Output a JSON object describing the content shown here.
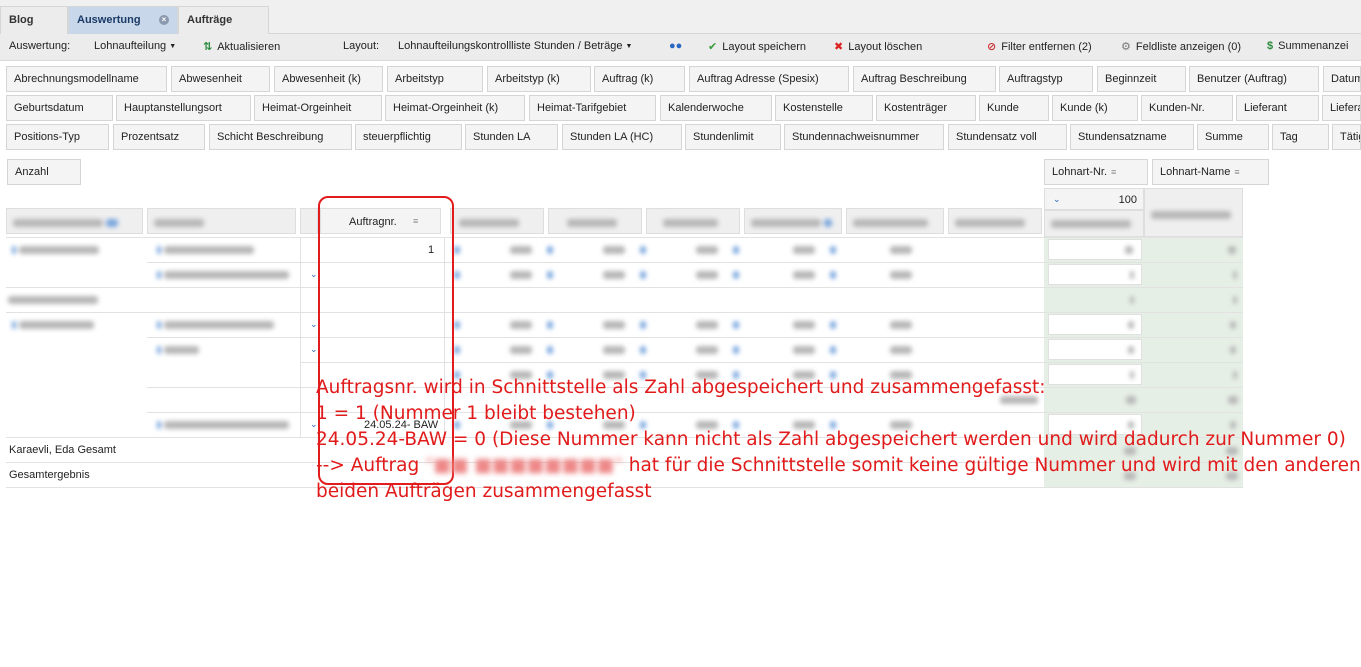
{
  "tabs": [
    {
      "label": "Blog"
    },
    {
      "label": "Auswertung",
      "active": true
    },
    {
      "label": "Aufträge"
    }
  ],
  "toolbar": {
    "auswertung_label": "Auswertung:",
    "auswertung_value": "Lohnaufteilung",
    "aktualisieren": "Aktualisieren",
    "layout_label": "Layout:",
    "layout_value": "Lohnaufteilungskontrollliste Stunden / Beträge",
    "layout_speichern": "Layout speichern",
    "layout_loeschen": "Layout löschen",
    "filter_entfernen": "Filter entfernen (2)",
    "feldliste": "Feldliste anzeigen (0)",
    "summen": "Summenanzei"
  },
  "fields": {
    "row1": [
      "Abrechnungsmodellname",
      "Abwesenheit",
      "Abwesenheit (k)",
      "Arbeitstyp",
      "Arbeitstyp (k)",
      "Auftrag (k)",
      "Auftrag Adresse (Spesix)",
      "Auftrag Beschreibung",
      "Auftragstyp",
      "Beginnzeit",
      "Benutzer (Auftrag)",
      "Datum"
    ],
    "row2": [
      "Geburtsdatum",
      "Hauptanstellungsort",
      "Heimat-Orgeinheit",
      "Heimat-Orgeinheit (k)",
      "Heimat-Tarifgebiet",
      "Kalenderwoche",
      "Kostenstelle",
      "Kostenträger",
      "Kunde",
      "Kunde (k)",
      "Kunden-Nr.",
      "Lieferant",
      "Liefera"
    ],
    "row3": [
      "Positions-Typ",
      "Prozentsatz",
      "Schicht Beschreibung",
      "steuerpflichtig",
      "Stunden LA",
      "Stunden LA (HC)",
      "Stundenlimit",
      "Stundennachweisnummer",
      "Stundensatz voll",
      "Stundensatzname",
      "Summe",
      "Tag",
      "Tätig"
    ]
  },
  "grid": {
    "data_area_button": "Anzahl",
    "column_buttons": [
      "Lohnart-Nr.",
      "Lohnart-Name"
    ],
    "column_value": "100",
    "auftragnr_header": "Auftragnr.",
    "auftragnr_values": [
      "1",
      "24.05.24- BAW"
    ],
    "group_total": "Karaevli, Eda Gesamt",
    "grand_total": "Gesamtergebnis"
  },
  "annotation": {
    "line1": "Auftragsnr. wird in Schnittstelle als Zahl abgespeichert und zusammengefasst:",
    "line2": "1 = 1 (Nummer 1 bleibt bestehen)",
    "line3": "24.05.24-BAW = 0 (Diese Nummer kann nicht als Zahl abgespeichert werden und wird dadurch zur Nummer 0)",
    "line4_pre": "--> Auftrag",
    "line4_post": "hat für die Schnittstelle somit keine gültige Nummer und wird mit den anderen",
    "line5": "beiden Aufträgen zusammengefasst"
  },
  "colors": {
    "annotation_red": "#e11b1b",
    "active_tab": "#c9d7ea",
    "total_green": "#e6efe6"
  }
}
